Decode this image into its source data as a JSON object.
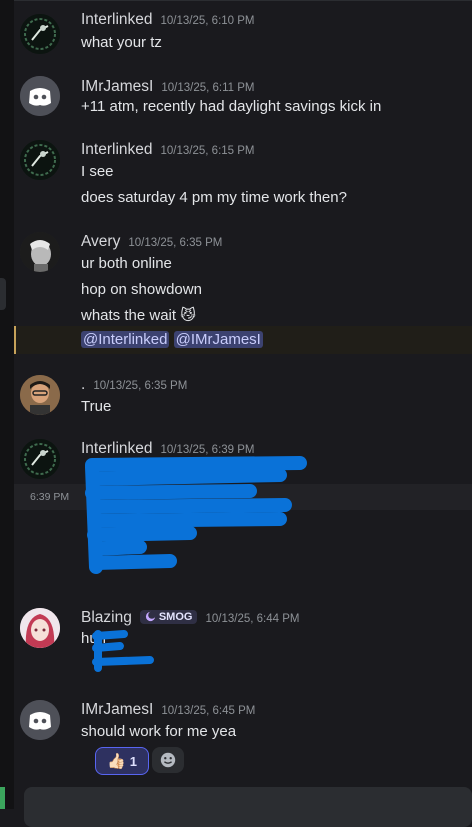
{
  "messages": [
    {
      "author": "Interlinked",
      "time": "10/13/25, 6:10 PM",
      "lines": [
        "what your tz"
      ]
    },
    {
      "author": "IMrJamesI",
      "time": "10/13/25, 6:11 PM",
      "lines": [
        "+11 atm, recently had daylight savings kick in"
      ]
    },
    {
      "author": "Interlinked",
      "time": "10/13/25, 6:15 PM",
      "lines": [
        "I see",
        "does saturday 4 pm my time work then?"
      ]
    },
    {
      "author": "Avery",
      "time": "10/13/25, 6:35 PM",
      "lines": [
        "ur both online",
        "hop on showdown",
        "whats the wait 😼"
      ],
      "mentions": [
        "@Interlinked",
        "@IMrJamesI"
      ]
    },
    {
      "author": ".",
      "time": "10/13/25, 6:35 PM",
      "lines": [
        "True"
      ]
    },
    {
      "author": "Interlinked",
      "time": "10/13/25, 6:39 PM",
      "hover_time": "6:39 PM"
    },
    {
      "author": "Blazing",
      "time": "10/13/25, 6:44 PM",
      "badge": "SMOG",
      "lines": [
        "huh"
      ]
    },
    {
      "author": "IMrJamesI",
      "time": "10/13/25, 6:45 PM",
      "lines": [
        "should work for me yea"
      ],
      "reactions": [
        {
          "emoji": "👍🏻",
          "count": "1"
        }
      ]
    }
  ],
  "colors": {
    "accent": "#5865f2",
    "mention_bg": "#3c4270",
    "redaction": "#0a72d8"
  }
}
